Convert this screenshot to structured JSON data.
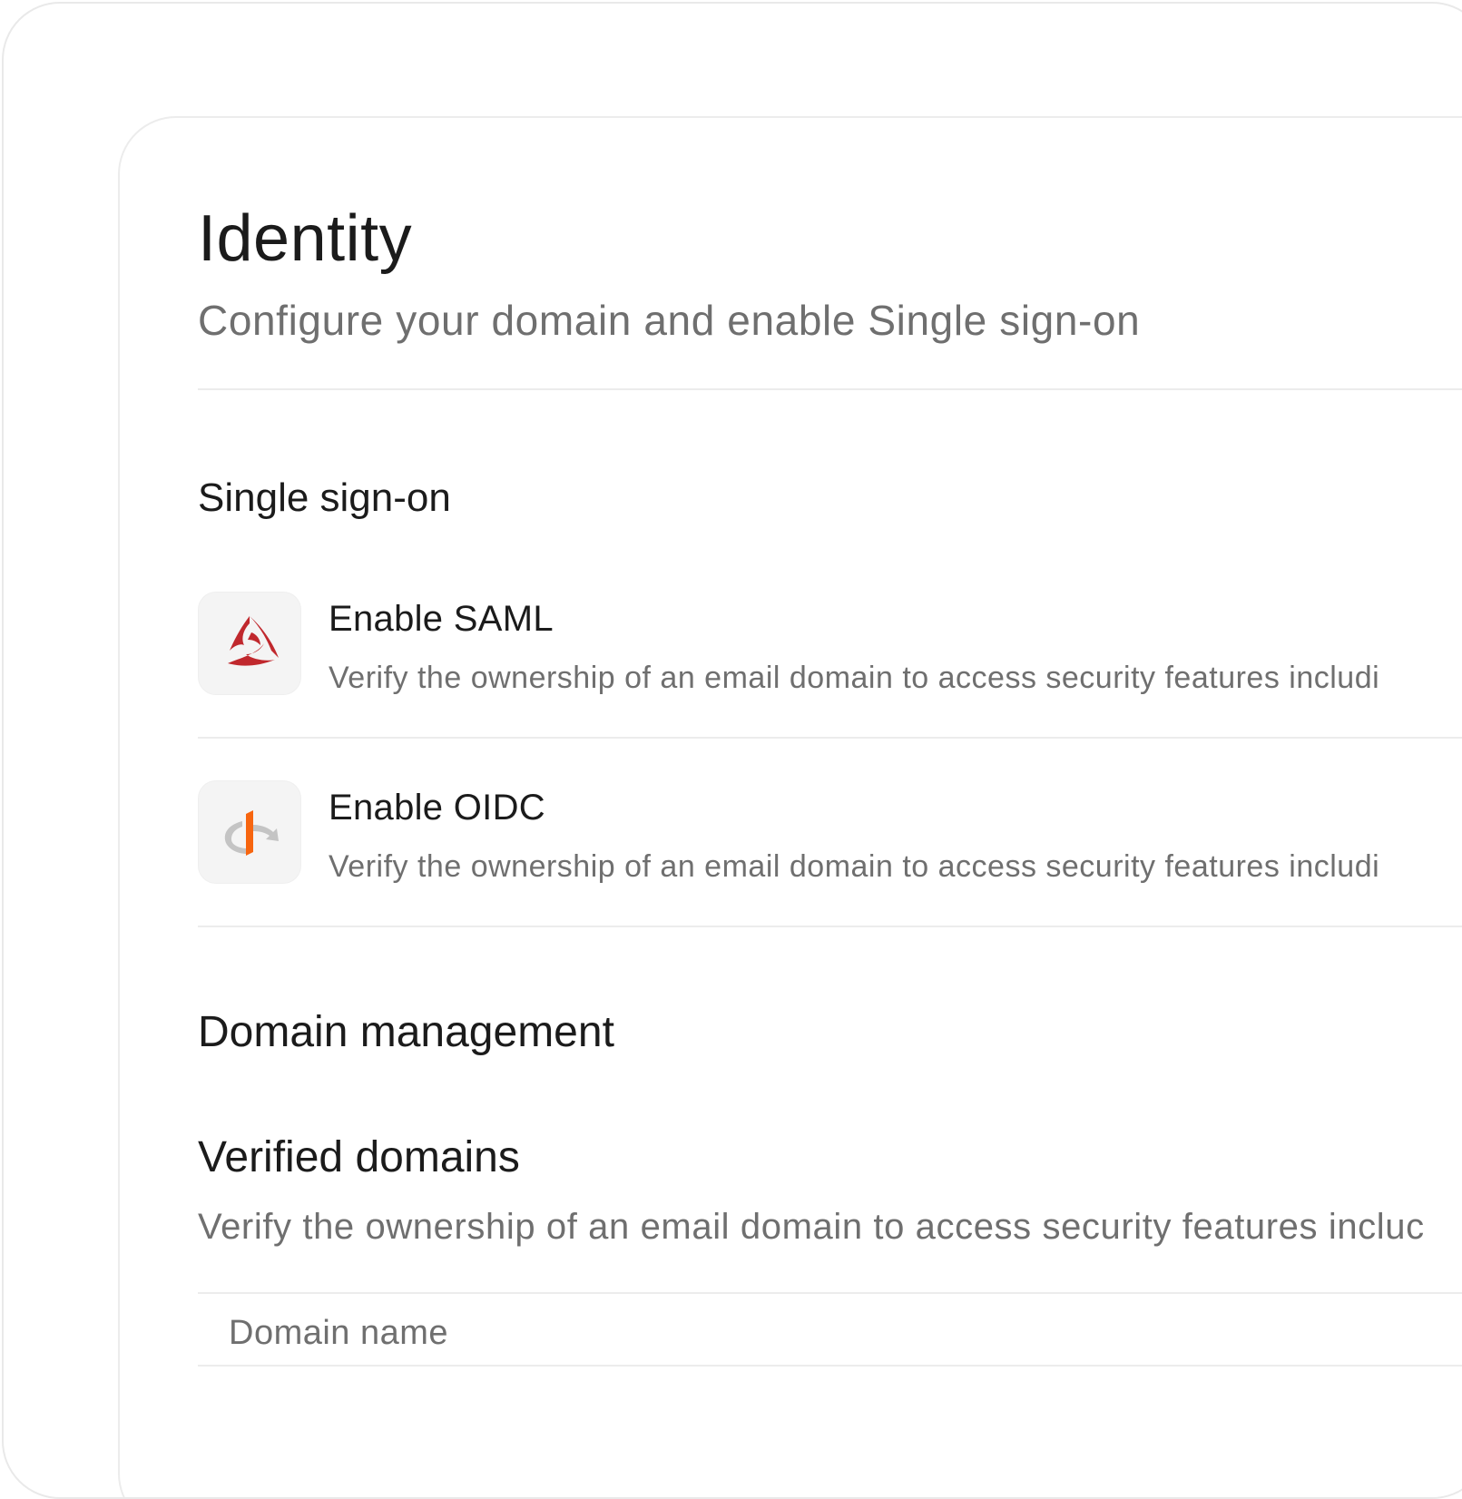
{
  "page": {
    "title": "Identity",
    "subtitle": "Configure your domain and enable Single sign-on"
  },
  "sso": {
    "heading": "Single sign-on",
    "items": [
      {
        "title": "Enable SAML",
        "description": "Verify the ownership of an email domain to access security features includi",
        "icon": "saml-logo-icon",
        "icon_color": "#c0282d"
      },
      {
        "title": "Enable OIDC",
        "description": "Verify the ownership of an email domain to access security features includi",
        "icon": "openid-logo-icon",
        "icon_color": "#f7650f"
      }
    ]
  },
  "domain_management": {
    "heading": "Domain management",
    "verified_domains": {
      "heading": "Verified domains",
      "description": "Verify the ownership of an email domain to access security features incluc",
      "table": {
        "columns": [
          "Domain name"
        ]
      }
    }
  },
  "colors": {
    "text_primary": "#1b1b1b",
    "text_secondary": "#6f6f6f",
    "divider": "#ececec",
    "icon_tile_bg": "#f4f4f4"
  }
}
